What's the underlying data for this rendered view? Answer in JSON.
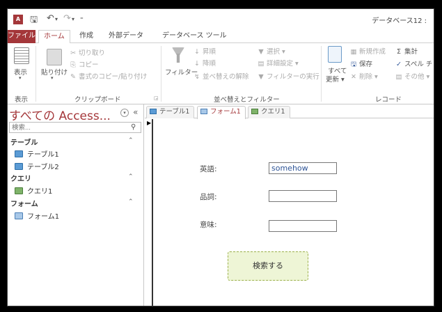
{
  "titlebar": {
    "app_icon": "A",
    "title": "データベース12 :",
    "qat_icons": [
      "save-icon",
      "undo-icon",
      "redo-icon",
      "customize-icon"
    ]
  },
  "ribbon_tabs": [
    {
      "label": "ファイル"
    },
    {
      "label": "ホーム"
    },
    {
      "label": "作成"
    },
    {
      "label": "外部データ"
    },
    {
      "label": "データベース ツール"
    }
  ],
  "ribbon": {
    "views": {
      "view_label": "表示",
      "group_label": "表示"
    },
    "clipboard": {
      "paste_label": "貼り付け",
      "cut_label": "切り取り",
      "copy_label": "コピー",
      "format_painter_label": "書式のコピー/貼り付け",
      "group_label": "クリップボード"
    },
    "sort_filter": {
      "filter_label": "フィルター",
      "ascending_label": "昇順",
      "descending_label": "降順",
      "remove_sort_label": "並べ替えの解除",
      "selection_label": "選択",
      "advanced_label": "詳細設定",
      "toggle_filter_label": "フィルターの実行",
      "group_label": "並べ替えとフィルター"
    },
    "records": {
      "refresh_label_1": "すべて",
      "refresh_label_2": "更新",
      "new_label": "新規作成",
      "save_label": "保存",
      "delete_label": "削除",
      "totals_label": "集計",
      "spelling_label": "スペル チ",
      "more_label": "その他",
      "group_label": "レコード"
    }
  },
  "nav_pane": {
    "title": "すべての Access...",
    "menu_symbol": "▾",
    "collapse_symbol": "«",
    "search_placeholder": "検索...",
    "groups": [
      {
        "label": "テーブル",
        "items": [
          {
            "label": "テーブル1"
          },
          {
            "label": "テーブル2"
          }
        ]
      },
      {
        "label": "クエリ",
        "items": [
          {
            "label": "クエリ1"
          }
        ]
      },
      {
        "label": "フォーム",
        "items": [
          {
            "label": "フォーム1"
          }
        ]
      }
    ]
  },
  "document_tabs": [
    {
      "label": "テーブル1"
    },
    {
      "label": "フォーム1",
      "active": true
    },
    {
      "label": "クエリ1"
    }
  ],
  "form": {
    "english_label": "英語:",
    "english_value": "somehow",
    "pos_label": "品詞:",
    "pos_value": "",
    "meaning_label": "意味:",
    "meaning_value": "",
    "search_button_label": "検索する"
  },
  "colors": {
    "accent": "#a4373a",
    "button_fill": "#eef5d6"
  }
}
